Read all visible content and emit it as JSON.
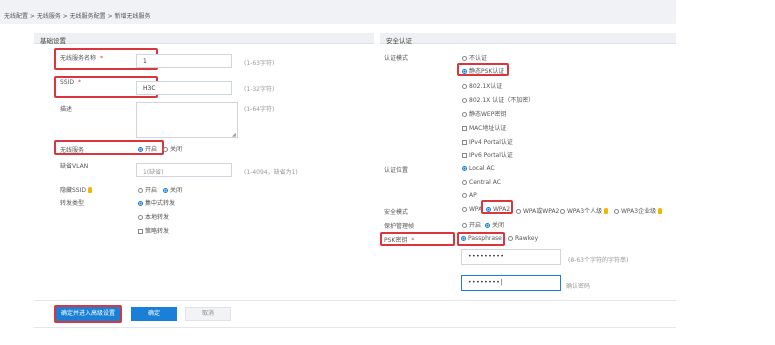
{
  "breadcrumb": "无线配置 > 无线服务 > 无线服务配置 > 新增无线服务",
  "basic": {
    "title": "基础设置",
    "service_name_label": "无线服务名称",
    "service_name_value": "1",
    "service_name_hint": "(1-63字符)",
    "ssid_label": "SSID",
    "ssid_value": "H3C",
    "ssid_hint": "(1-32字符)",
    "desc_label": "描述",
    "desc_hint": "(1-64字符)",
    "wireless_label": "无线服务",
    "wireless_on": "开启",
    "wireless_off": "关闭",
    "vlan_label": "缺省VLAN",
    "vlan_placeholder": "1(缺省)",
    "vlan_hint": "(1-4094，缺省为1)",
    "hide_ssid_label": "隐藏SSID",
    "hide_on": "开启",
    "hide_off": "关闭",
    "forward_label": "转发类型",
    "forward_central": "集中式转发",
    "forward_local": "本地转发",
    "forward_policy": "策略转发"
  },
  "security": {
    "title": "安全认证",
    "auth_mode_label": "认证模式",
    "auth_options": [
      "不认证",
      "静态PSK认证",
      "802.1X认证",
      "802.1X 认证（不加密）",
      "静态WEP密钥",
      "MAC地址认证",
      "IPv4 Portal认证",
      "IPv6 Portal认证"
    ],
    "auth_location_label": "认证位置",
    "location_options": [
      "Local AC",
      "Central AC",
      "AP"
    ],
    "sec_mode_label": "安全模式",
    "sec_options": [
      "WPA",
      "WPA2",
      "WPA或WPA2",
      "WPA3个人级",
      "WPA3企业级"
    ],
    "mgmt_label": "保护管理帧",
    "mgmt_on": "开启",
    "mgmt_off": "关闭",
    "psk_label": "PSK密钥",
    "psk_type_1": "Passphrase",
    "psk_type_2": "Rawkey",
    "psk_value": "•••••••••",
    "psk_hint": "(8-63个字符的字符串)",
    "psk_confirm_value": "••••••••|",
    "psk_confirm_hint": "确认密码"
  },
  "footer": {
    "save_advanced": "确定并进入高级设置",
    "ok": "确定",
    "cancel": "取消"
  },
  "colors": {
    "accent": "#1a7fd6",
    "highlight": "#d9363e"
  }
}
